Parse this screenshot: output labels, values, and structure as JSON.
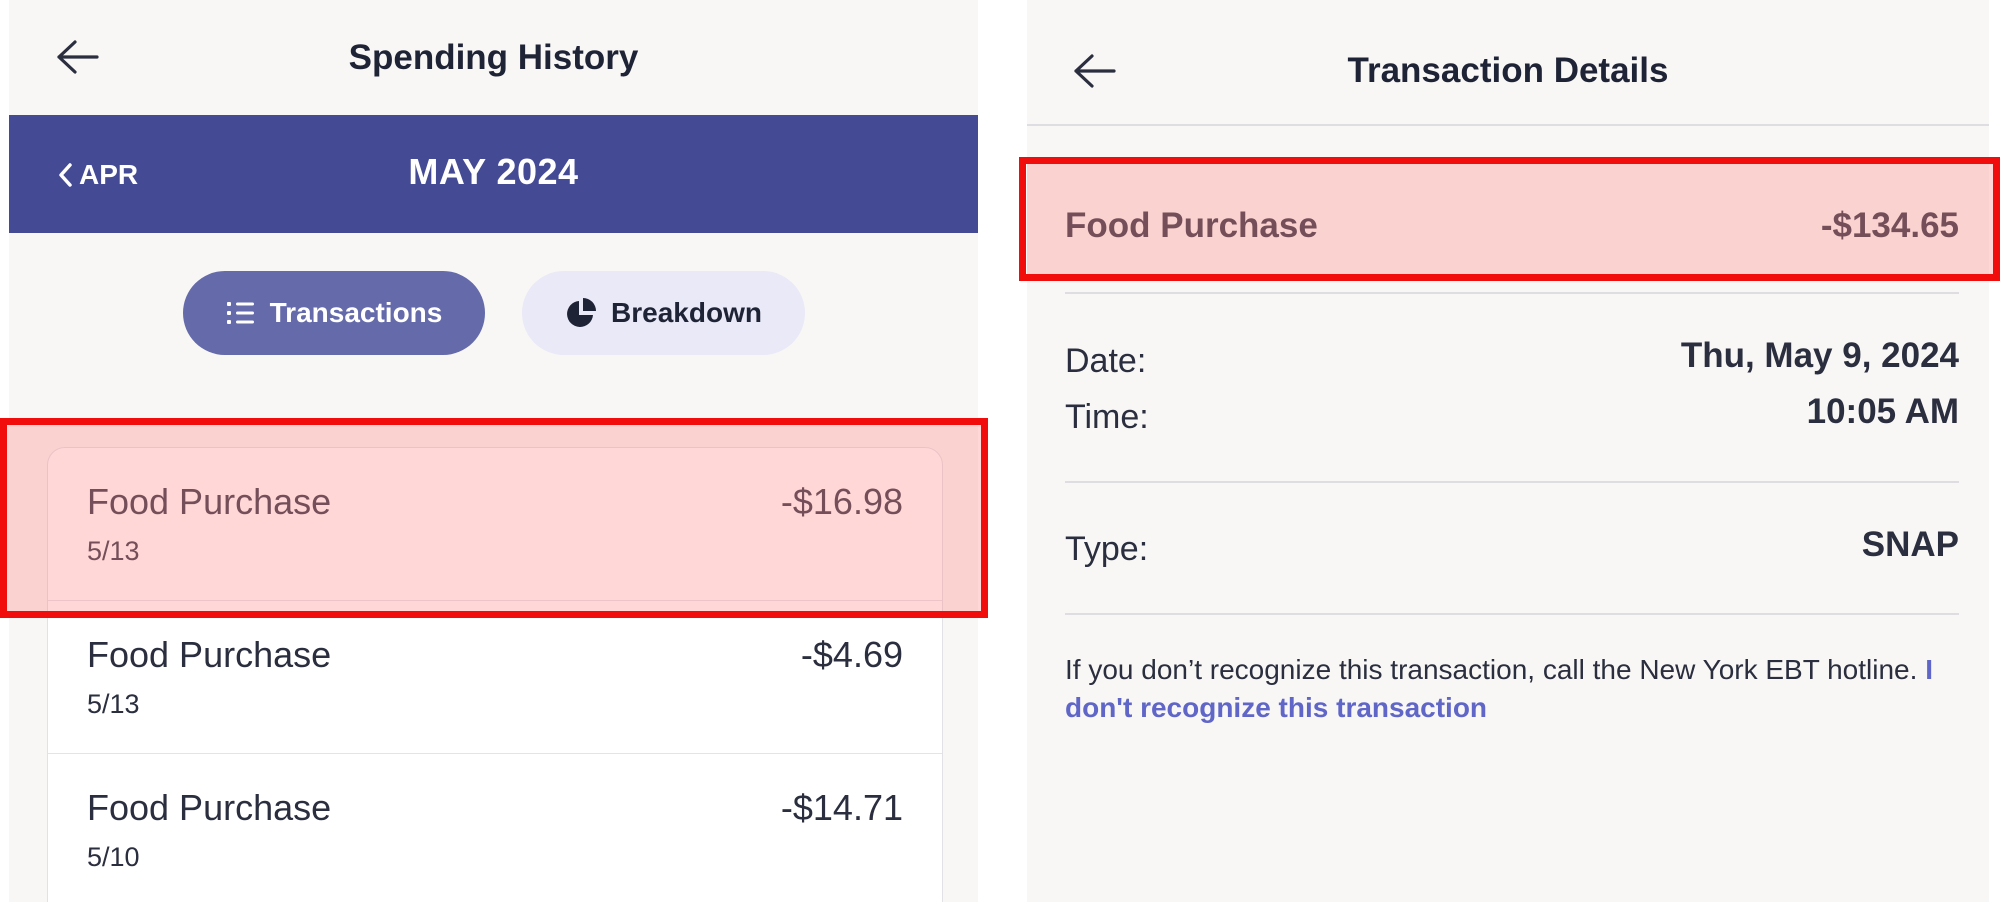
{
  "left_screen": {
    "title": "Spending History",
    "month_nav": {
      "prev_label": "APR",
      "current_month": "MAY 2024"
    },
    "tabs": [
      {
        "label": "Transactions",
        "icon": "list-icon",
        "active": true
      },
      {
        "label": "Breakdown",
        "icon": "pie-chart-icon",
        "active": false
      }
    ],
    "transactions": [
      {
        "name": "Food Purchase",
        "date": "5/13",
        "amount": "-$16.98"
      },
      {
        "name": "Food Purchase",
        "date": "5/13",
        "amount": "-$4.69"
      },
      {
        "name": "Food Purchase",
        "date": "5/10",
        "amount": "-$14.71"
      }
    ]
  },
  "right_screen": {
    "title": "Transaction Details",
    "transaction": {
      "name": "Food Purchase",
      "amount": "-$134.65"
    },
    "details": {
      "date_label": "Date:",
      "date_value": "Thu, May 9, 2024",
      "time_label": "Time:",
      "time_value": "10:05 AM",
      "type_label": "Type:",
      "type_value": "SNAP"
    },
    "info_text": "If you don’t recognize this transaction, call the New York EBT hotline. ",
    "info_link": "I don't recognize this transaction"
  },
  "colors": {
    "month_bar": "#444a94",
    "active_tab": "#646aaa",
    "inactive_tab": "#e9e9f7",
    "link": "#6066c7",
    "highlight_border": "#f20d0d"
  }
}
